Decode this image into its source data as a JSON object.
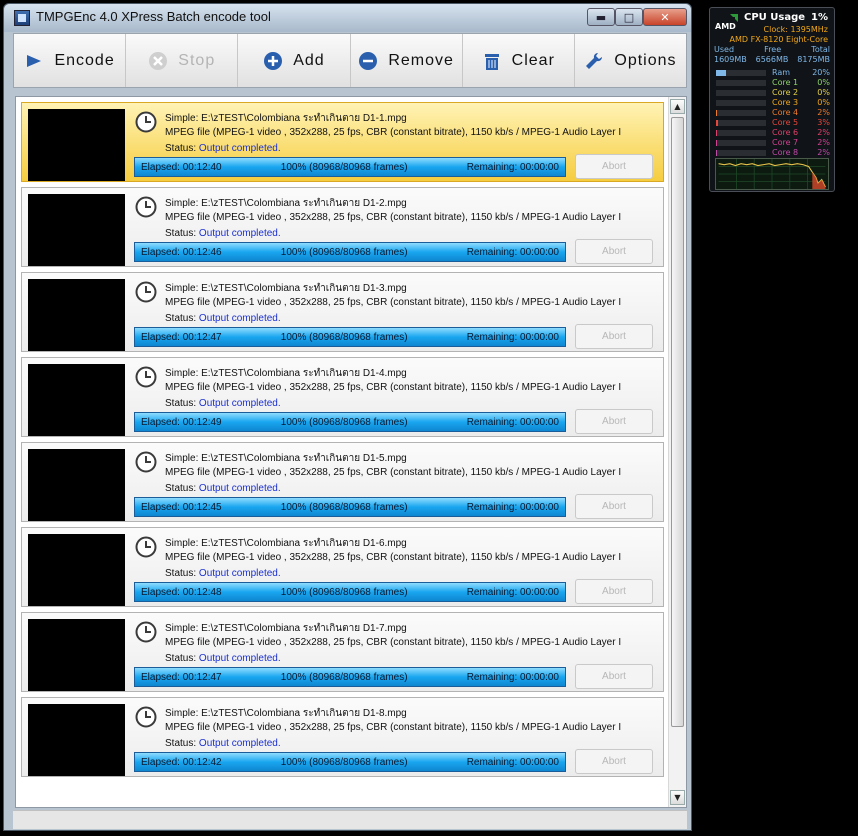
{
  "window": {
    "title": "TMPGEnc 4.0 XPress Batch encode tool",
    "minimize": "▬",
    "maximize": "□",
    "close": "✕"
  },
  "toolbar": {
    "encode": "Encode",
    "stop": "Stop",
    "add": "Add",
    "remove": "Remove",
    "clear": "Clear",
    "options": "Options"
  },
  "items": [
    {
      "name": "Simple: E:\\zTEST\\Colombiana ระทำเกินตาย D1-1.mpg",
      "info": "MPEG file (MPEG-1 video , 352x288, 25 fps, CBR (constant bitrate), 1150 kb/s / MPEG-1 Audio Layer I",
      "status_label": "Status:",
      "status": "Output completed.",
      "elapsed": "Elapsed: 00:12:40",
      "progress": "100% (80968/80968  frames)",
      "progress_value": 100,
      "remaining": "Remaining: 00:00:00",
      "abort": "Abort"
    },
    {
      "name": "Simple: E:\\zTEST\\Colombiana ระทำเกินตาย D1-2.mpg",
      "info": "MPEG file (MPEG-1 video , 352x288, 25 fps, CBR (constant bitrate), 1150 kb/s / MPEG-1 Audio Layer I",
      "status_label": "Status:",
      "status": "Output completed.",
      "elapsed": "Elapsed: 00:12:46",
      "progress": "100% (80968/80968  frames)",
      "progress_value": 100,
      "remaining": "Remaining: 00:00:00",
      "abort": "Abort"
    },
    {
      "name": "Simple: E:\\zTEST\\Colombiana ระทำเกินตาย D1-3.mpg",
      "info": "MPEG file (MPEG-1 video , 352x288, 25 fps, CBR (constant bitrate), 1150 kb/s / MPEG-1 Audio Layer I",
      "status_label": "Status:",
      "status": "Output completed.",
      "elapsed": "Elapsed: 00:12:47",
      "progress": "100% (80968/80968  frames)",
      "progress_value": 100,
      "remaining": "Remaining: 00:00:00",
      "abort": "Abort"
    },
    {
      "name": "Simple: E:\\zTEST\\Colombiana ระทำเกินตาย D1-4.mpg",
      "info": "MPEG file (MPEG-1 video , 352x288, 25 fps, CBR (constant bitrate), 1150 kb/s / MPEG-1 Audio Layer I",
      "status_label": "Status:",
      "status": "Output completed.",
      "elapsed": "Elapsed: 00:12:49",
      "progress": "100% (80968/80968  frames)",
      "progress_value": 100,
      "remaining": "Remaining: 00:00:00",
      "abort": "Abort"
    },
    {
      "name": "Simple: E:\\zTEST\\Colombiana ระทำเกินตาย D1-5.mpg",
      "info": "MPEG file (MPEG-1 video , 352x288, 25 fps, CBR (constant bitrate), 1150 kb/s / MPEG-1 Audio Layer I",
      "status_label": "Status:",
      "status": "Output completed.",
      "elapsed": "Elapsed: 00:12:45",
      "progress": "100% (80968/80968  frames)",
      "progress_value": 100,
      "remaining": "Remaining: 00:00:00",
      "abort": "Abort"
    },
    {
      "name": "Simple: E:\\zTEST\\Colombiana ระทำเกินตาย D1-6.mpg",
      "info": "MPEG file (MPEG-1 video , 352x288, 25 fps, CBR (constant bitrate), 1150 kb/s / MPEG-1 Audio Layer I",
      "status_label": "Status:",
      "status": "Output completed.",
      "elapsed": "Elapsed: 00:12:48",
      "progress": "100% (80968/80968  frames)",
      "progress_value": 100,
      "remaining": "Remaining: 00:00:00",
      "abort": "Abort"
    },
    {
      "name": "Simple: E:\\zTEST\\Colombiana ระทำเกินตาย D1-7.mpg",
      "info": "MPEG file (MPEG-1 video , 352x288, 25 fps, CBR (constant bitrate), 1150 kb/s / MPEG-1 Audio Layer I",
      "status_label": "Status:",
      "status": "Output completed.",
      "elapsed": "Elapsed: 00:12:47",
      "progress": "100% (80968/80968  frames)",
      "progress_value": 100,
      "remaining": "Remaining: 00:00:00",
      "abort": "Abort"
    },
    {
      "name": "Simple: E:\\zTEST\\Colombiana ระทำเกินตาย D1-8.mpg",
      "info": "MPEG file (MPEG-1 video , 352x288, 25 fps, CBR (constant bitrate), 1150 kb/s / MPEG-1 Audio Layer I",
      "status_label": "Status:",
      "status": "Output completed.",
      "elapsed": "Elapsed: 00:12:42",
      "progress": "100% (80968/80968  frames)",
      "progress_value": 100,
      "remaining": "Remaining: 00:00:00",
      "abort": "Abort"
    }
  ],
  "gadget": {
    "title": "CPU Usage",
    "percent": "1%",
    "clock": "Clock: 1395MHz",
    "cpu": "AMD FX-8120 Eight-Core",
    "mem_headers": [
      "Used",
      "Free",
      "Total"
    ],
    "mem_values": [
      "1609MB",
      "6566MB",
      "8175MB"
    ],
    "rows": [
      {
        "label": "Ram",
        "value": "20%",
        "level": 20,
        "color": "#7fb7e8"
      },
      {
        "label": "Core 1",
        "value": "0%",
        "level": 0,
        "color": "#8fd26a"
      },
      {
        "label": "Core 2",
        "value": "0%",
        "level": 0,
        "color": "#e6d24a"
      },
      {
        "label": "Core 3",
        "value": "0%",
        "level": 0,
        "color": "#f2a818"
      },
      {
        "label": "Core 4",
        "value": "2%",
        "level": 2,
        "color": "#f07a2a"
      },
      {
        "label": "Core 5",
        "value": "3%",
        "level": 3,
        "color": "#e6463c"
      },
      {
        "label": "Core 6",
        "value": "2%",
        "level": 2,
        "color": "#e0406a"
      },
      {
        "label": "Core 7",
        "value": "2%",
        "level": 2,
        "color": "#d44090"
      },
      {
        "label": "Core 8",
        "value": "2%",
        "level": 2,
        "color": "#c04aa8"
      }
    ]
  },
  "colors": {
    "selected_item": "#f6cd40",
    "progress": "#19a6ef",
    "status_text": "#1a2fd0"
  }
}
